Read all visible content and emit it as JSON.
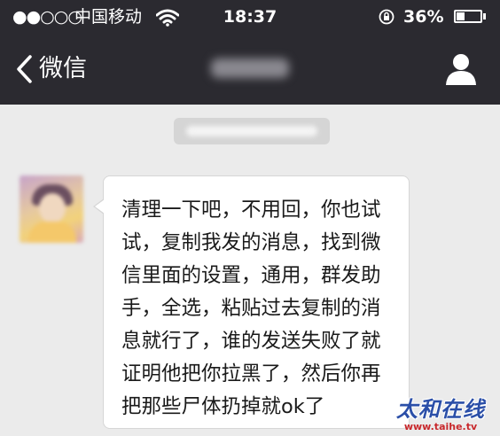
{
  "status_bar": {
    "signal": "●●○○○",
    "carrier": "中国移动",
    "time": "18:37",
    "battery_percent": "36%",
    "battery_level": 0.36,
    "icons": [
      "wifi-icon",
      "rotation-lock-icon",
      "battery-icon"
    ]
  },
  "nav": {
    "back_label": "微信",
    "title": "",
    "icons": {
      "back": "chevron-left-icon",
      "profile": "person-icon"
    }
  },
  "chat": {
    "timestamp": "",
    "messages": [
      {
        "side": "left",
        "text": "清理一下吧，不用回，你也试试，复制我发的消息，找到微信里面的设置，通用，群发助手，全选，粘贴过去复制的消息就行了，谁的发送失败了就证明他把你拉黑了，然后你再把那些尸体扔掉就ok了"
      }
    ]
  },
  "watermark": {
    "name": "太和在线",
    "url": "www.taihe.tv"
  },
  "colors": {
    "nav_background": "#2b2a30",
    "chat_background": "#ebebeb",
    "bubble": "#ffffff",
    "watermark_blue": "#2b4fa8",
    "watermark_red": "#c8282c"
  }
}
